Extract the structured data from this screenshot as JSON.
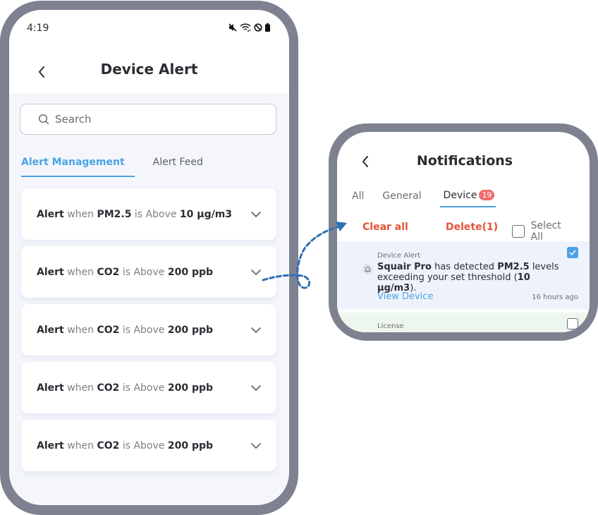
{
  "left_screen": {
    "status": {
      "time": "4:19",
      "icons": [
        "mute-icon",
        "wifi-icon",
        "do-not-disturb-icon",
        "battery-icon"
      ]
    },
    "title": "Device Alert",
    "search": {
      "placeholder": "Search",
      "value": ""
    },
    "tabs": [
      {
        "label": "Alert Management",
        "active": true
      },
      {
        "label": "Alert Feed",
        "active": false
      }
    ],
    "alerts": [
      {
        "prefix": "Alert",
        "when": "when",
        "metric": "PM2.5",
        "is_above": "is Above",
        "value": "10 µg/m3"
      },
      {
        "prefix": "Alert",
        "when": "when",
        "metric": "CO2",
        "is_above": "is Above",
        "value": "200 ppb"
      },
      {
        "prefix": "Alert",
        "when": "when",
        "metric": "CO2",
        "is_above": "is Above",
        "value": "200 ppb"
      },
      {
        "prefix": "Alert",
        "when": "when",
        "metric": "CO2",
        "is_above": "is Above",
        "value": "200 ppb"
      },
      {
        "prefix": "Alert",
        "when": "when",
        "metric": "CO2",
        "is_above": "is Above",
        "value": "200 ppb"
      }
    ]
  },
  "right_screen": {
    "title": "Notifications",
    "tabs": [
      {
        "label": "All",
        "active": false
      },
      {
        "label": "General",
        "active": false
      },
      {
        "label": "Device",
        "active": true,
        "badge": "19"
      }
    ],
    "actions": {
      "clear_all": "Clear all",
      "delete": "Delete(1)",
      "select_all": "Select All",
      "select_all_checked": false
    },
    "notifications": [
      {
        "category": "Device Alert",
        "device": "Squair Pro",
        "text_1": " has detected ",
        "metric": "PM2.5",
        "text_2": " levels exceeding your set threshold (",
        "threshold": "10 µg/m3",
        "text_3": ").",
        "link": "View Device",
        "time": "16 hours ago",
        "checked": true
      },
      {
        "category": "License",
        "checked": false
      }
    ]
  },
  "colors": {
    "accent_blue": "#4aa3e6",
    "danger_red": "#e4533a",
    "badge_red": "#ee6b6b",
    "frame_gray": "#7e8190",
    "arrow_blue": "#2f6fb3"
  }
}
